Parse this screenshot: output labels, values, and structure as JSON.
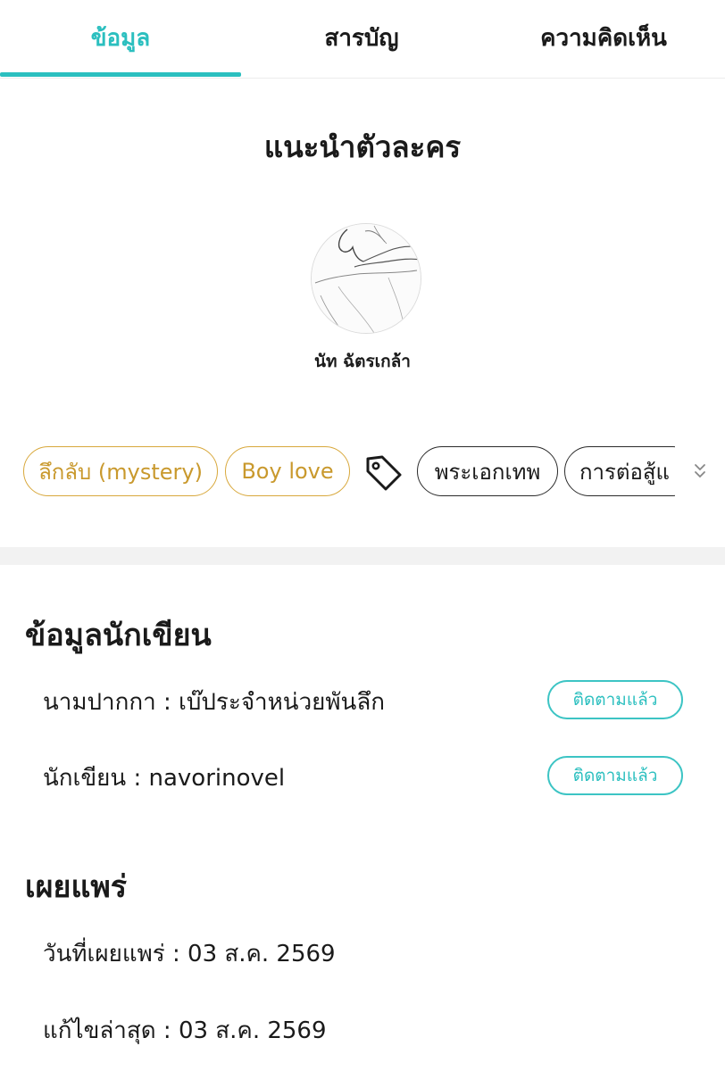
{
  "tabs": [
    {
      "label": "ข้อมูล",
      "active": true
    },
    {
      "label": "สารบัญ",
      "active": false
    },
    {
      "label": "ความคิดเห็น",
      "active": false
    }
  ],
  "character_section": {
    "title": "แนะนำตัวละคร",
    "character_name": "นัท ฉัตรเกล้า"
  },
  "tags": {
    "genres": [
      "ลึกลับ (mystery)",
      "Boy love"
    ],
    "keywords": [
      "พระเอกเทพ",
      "การต่อสู้แ"
    ]
  },
  "writer_info": {
    "title": "ข้อมูลนักเขียน",
    "pen_name_label": "นามปากกา : ",
    "pen_name": "เบ๊ประจำหน่วยพันลึก",
    "writer_label": "นักเขียน : ",
    "writer": "navorinovel",
    "follow_label": "ติดตามแล้ว"
  },
  "publish_info": {
    "title": "เผยแพร่",
    "published_label": "วันที่เผยแพร่ : ",
    "published_date": "03 ส.ค. 2569",
    "edited_label": "แก้ไขล่าสุด : ",
    "edited_date": "03 ส.ค. 2569"
  },
  "colors": {
    "accent": "#2bbfbf",
    "genre_tag": "#c9992d",
    "text": "#1a1a1a"
  },
  "icons": [
    "tag-icon",
    "expand-down-icon"
  ]
}
